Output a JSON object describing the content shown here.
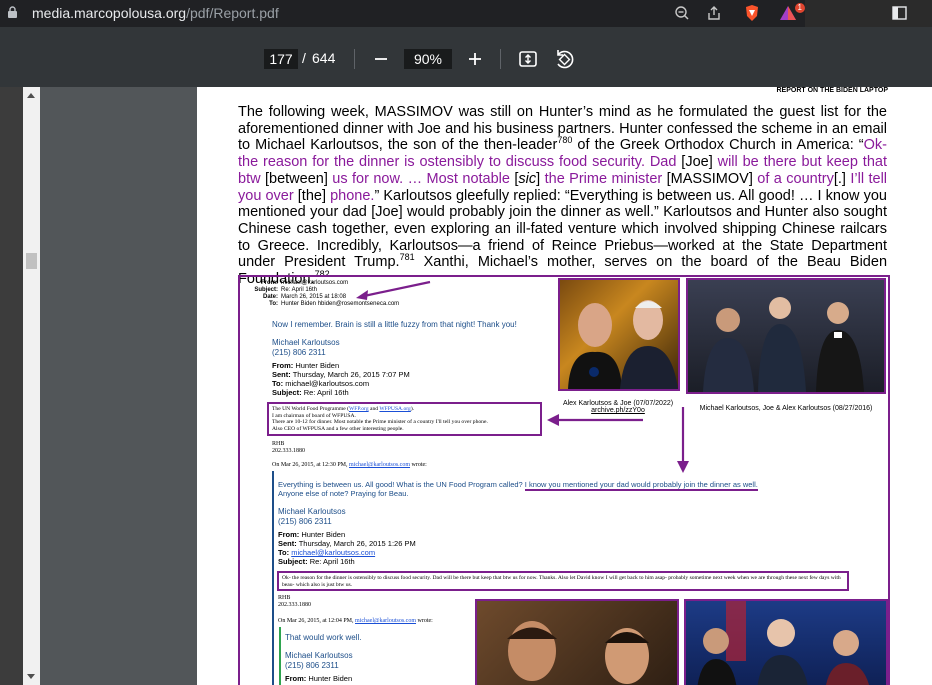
{
  "browser": {
    "url_host": "media.marcopolousa.org",
    "url_path": "/pdf/Report.pdf",
    "notif_count": "1"
  },
  "pdf_toolbar": {
    "page": "177",
    "separator": "/",
    "total_pages": "644",
    "zoom": "90%"
  },
  "page": {
    "header": "REPORT ON THE BIDEN LAPTOP",
    "paragraph": [
      {
        "t": "The following week, MASSIMOV was still on Hunter’s mind as he formulated the guest list for the aforementioned dinner with Joe and his business partners. Hunter confessed the scheme in an email to Michael Karloutsos, the son of the then-leader"
      },
      {
        "t": "780",
        "sup": true
      },
      {
        "t": " of the Greek Orthodox Church in America: “"
      },
      {
        "t": "Ok-the reason for the dinner is ostensibly to discuss food security. Dad",
        "p": true
      },
      {
        "t": " [Joe] "
      },
      {
        "t": "will be there but keep that btw",
        "p": true
      },
      {
        "t": " [between] "
      },
      {
        "t": "us for now. … Most notable",
        "p": true
      },
      {
        "t": " ["
      },
      {
        "t": "sic",
        "i": true
      },
      {
        "t": "] "
      },
      {
        "t": "the Prime minister",
        "p": true
      },
      {
        "t": " [MASSIMOV] "
      },
      {
        "t": "of a country",
        "p": true
      },
      {
        "t": "[.] "
      },
      {
        "t": "I’ll tell you over",
        "p": true
      },
      {
        "t": " [the] "
      },
      {
        "t": "phone.",
        "p": true
      },
      {
        "t": "” Karloutsos gleefully replied: “Everything is between us. All good! … I know you mentioned your dad [Joe] would probably join the dinner as well.” Karloutsos and Hunter also sought Chinese cash together, even exploring an ill-fated venture which involved shipping Chinese railcars to Greece. Incredibly, Karloutsos—a friend of Reince Priebus—worked at the State Department under President Trump."
      },
      {
        "t": "781",
        "sup": true
      },
      {
        "t": " Xanthi, Michael’s mother, serves on the board of the Beau Biden Foundation."
      },
      {
        "t": "782",
        "sup": true
      }
    ]
  },
  "exhibit": {
    "email1": {
      "from_label": "From:",
      "from": "michael@karloutsos.com",
      "subject_label": "Subject:",
      "subject": "Re: April 16th",
      "date_label": "Date:",
      "date": "March 26, 2015 at 18:08",
      "to_label": "To:",
      "to": "Hunter Biden hbiden@rosemontseneca.com"
    },
    "reply1": "Now I remember. Brain is still a little fuzzy from that night! Thank you!",
    "sig_name": "Michael Karloutsos",
    "sig_phone": "(215) 806 2311",
    "quoted1": {
      "from_label": "From:",
      "from": "Hunter Biden",
      "sent_label": "Sent:",
      "sent": "Thursday, March 26, 2015 7:07 PM",
      "to_label": "To:",
      "to": "michael@karloutsos.com",
      "subject_label": "Subject:",
      "subject": "Re: April 16th"
    },
    "box1_pre": "The UN World Food Programme (",
    "box1_link1": "WFP.org",
    "box1_and": " and ",
    "box1_link2": "WFPUSA.org",
    "box1_post": ").",
    "box1_l2": "I am chairman of board of WFPUSA.",
    "box1_l3": "There are 10-12 for dinner. Most notable the Prime minister of a country I'll tell you over phone.",
    "box1_l4": "Also CEO of WFPUSA and a few other interesting people.",
    "rhb": "RHB",
    "rhb_phone": "202.333.1880",
    "wrote1_pre": "On Mar 26, 2015, at 12:30 PM, ",
    "wrote1_link": "michael@karloutsos.com",
    "wrote1_post": " wrote:",
    "reply2_a": "Everything is between us. All good! What is the UN Food Program called? ",
    "reply2_b": "I know you mentioned your dad would probably join the dinner as well.",
    "reply2_c": "Anyone else of note? Praying for Beau.",
    "quoted2": {
      "from_label": "From:",
      "from": "Hunter Biden",
      "sent_label": "Sent:",
      "sent": "Thursday, March 26, 2015 1:26 PM",
      "to_label": "To:",
      "to": "michael@karloutsos.com",
      "subject_label": "Subject:",
      "subject": "Re: April 16th"
    },
    "box2": "Ok- the reason for the dinner is ostensibly to discuss food security. Dad will be there but keep that btw us for now. Thanks.  Also let David know I will get back to him asap- probably sometime next week when we are through these next few days with beau- which also is just btw us.",
    "wrote2_pre": "On Mar 26, 2015, at 12:04 PM, ",
    "wrote2_link": "michael@karloutsos.com",
    "wrote2_post": " wrote:",
    "reply3": "That would work well.",
    "quoted3_from_label": "From:",
    "quoted3_from": "Hunter Biden",
    "caption1_l1": "Alex Karloutsos & Joe (07/07/2022)",
    "caption1_l2": "archive.ph/zzY0o",
    "caption2": "Michael Karloutsos, Joe & Alex Karloutsos (08/27/2016)"
  }
}
